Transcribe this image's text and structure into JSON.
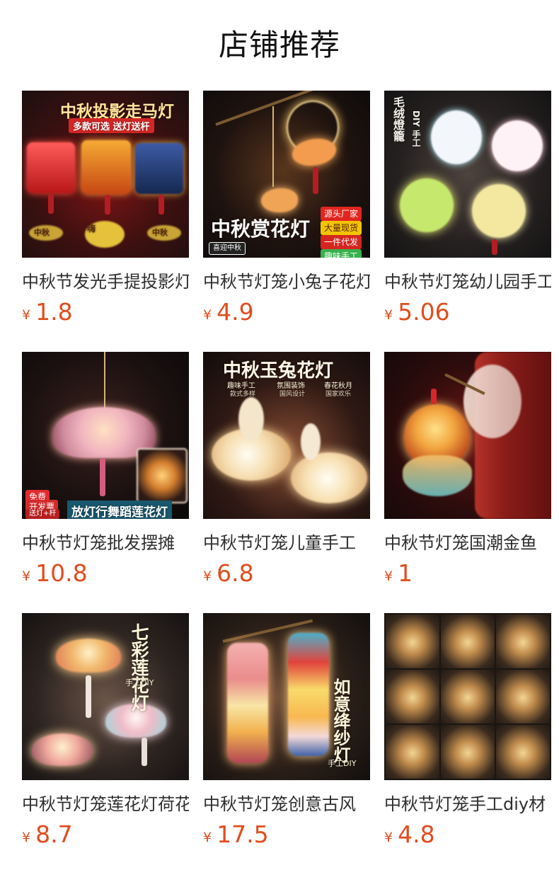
{
  "page": {
    "title": "店铺推荐"
  },
  "products": [
    {
      "name": "中秋节发光手提投影灯",
      "currency": "¥",
      "price": "1.8",
      "image_text": {
        "headline": "中秋投影走马灯",
        "subline": "多款可选 送灯送杆",
        "stickers": [
          "嗨",
          "中秋",
          "中秋"
        ]
      }
    },
    {
      "name": "中秋节灯笼小兔子花灯",
      "currency": "¥",
      "price": "4.9",
      "image_text": {
        "headline": "中秋赏花灯",
        "tags": [
          "源头厂家",
          "大量现货",
          "一件代发",
          "趣味手工"
        ],
        "small_stamp": "喜迎中秋"
      }
    },
    {
      "name": "中秋节灯笼幼儿园手工",
      "currency": "¥",
      "price": "5.06",
      "image_text": {
        "title_left": "毛绒燈籠",
        "title_right": "DIY 手工"
      }
    },
    {
      "name": "中秋节灯笼批发摆摊",
      "currency": "¥",
      "price": "10.8",
      "image_text": {
        "headline": "放灯行舞蹈莲花灯",
        "badge_top": "免费",
        "badge_mid": "开发票",
        "badge_bottom": "送灯+杆"
      }
    },
    {
      "name": "中秋节灯笼儿童手工",
      "currency": "¥",
      "price": "6.8",
      "image_text": {
        "headline": "中秋玉兔花灯",
        "features": [
          {
            "title": "趣味手工",
            "sub": "款式多样"
          },
          {
            "title": "氛围装饰",
            "sub": "国风设计"
          },
          {
            "title": "春花秋月",
            "sub": "国家欢乐"
          }
        ]
      }
    },
    {
      "name": "中秋节灯笼国潮金鱼",
      "currency": "¥",
      "price": "1",
      "image_text": {}
    },
    {
      "name": "中秋节灯笼莲花灯荷花",
      "currency": "¥",
      "price": "8.7",
      "image_text": {
        "title": "七彩莲花灯",
        "tag": "手工DIY"
      }
    },
    {
      "name": "中秋节灯笼创意古风",
      "currency": "¥",
      "price": "17.5",
      "image_text": {
        "title": "如意绛纱灯",
        "tag": "手工DIY"
      }
    },
    {
      "name": "中秋节灯笼手工diy材",
      "currency": "¥",
      "price": "4.8",
      "image_text": {}
    }
  ],
  "colors": {
    "price": "#e04d1d",
    "title": "#111111",
    "text": "#2e2e2e"
  }
}
